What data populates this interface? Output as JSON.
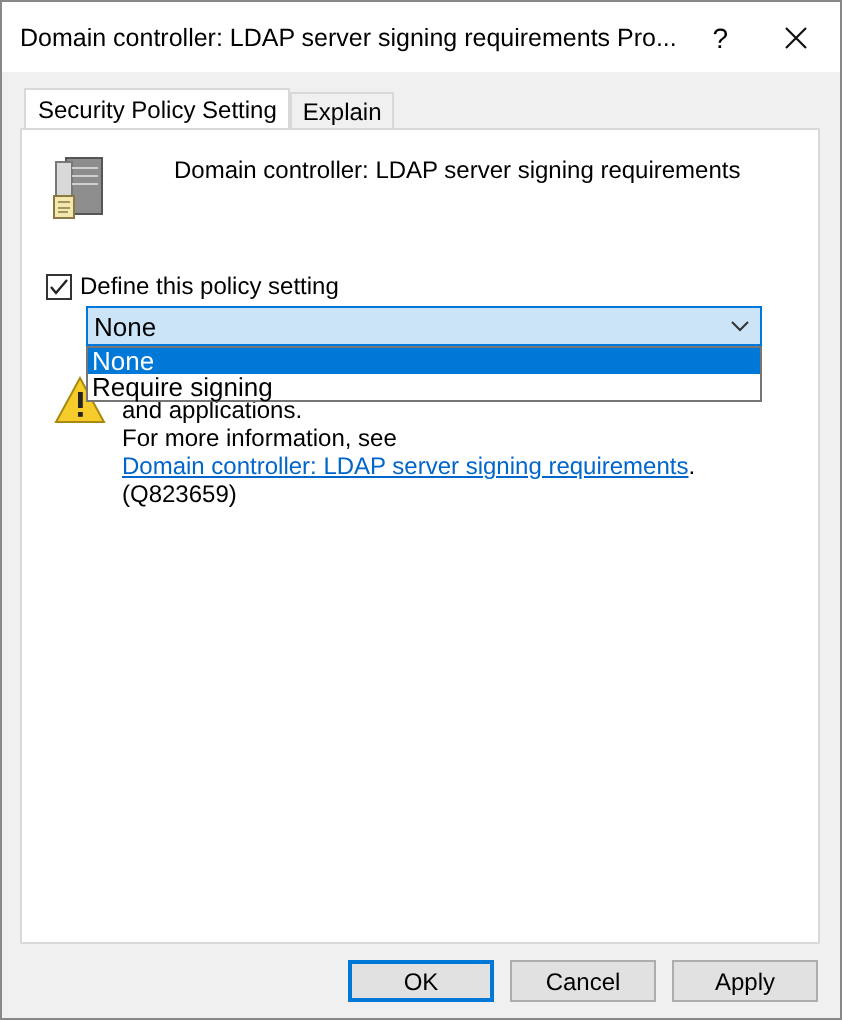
{
  "window": {
    "title": "Domain controller: LDAP server signing requirements Pro...",
    "help": "?"
  },
  "tabs": [
    {
      "label": "Security Policy Setting",
      "selected": true
    },
    {
      "label": "Explain",
      "selected": false
    }
  ],
  "policy_name": "Domain controller: LDAP server signing requirements",
  "define_setting": {
    "label": "Define this policy setting",
    "checked": true
  },
  "dropdown": {
    "value": "None",
    "expanded": true,
    "options": [
      {
        "label": "None",
        "selected": true
      },
      {
        "label": "Require signing",
        "selected": false
      }
    ]
  },
  "warning": {
    "text": "and applications.",
    "more_prefix": "For more information, see",
    "link": "Domain controller: LDAP server signing requirements",
    "more_suffix": ". (Q823659)"
  },
  "buttons": [
    {
      "label": "OK",
      "focused": true
    },
    {
      "label": "Cancel",
      "focused": false
    },
    {
      "label": "Apply",
      "focused": false
    }
  ]
}
